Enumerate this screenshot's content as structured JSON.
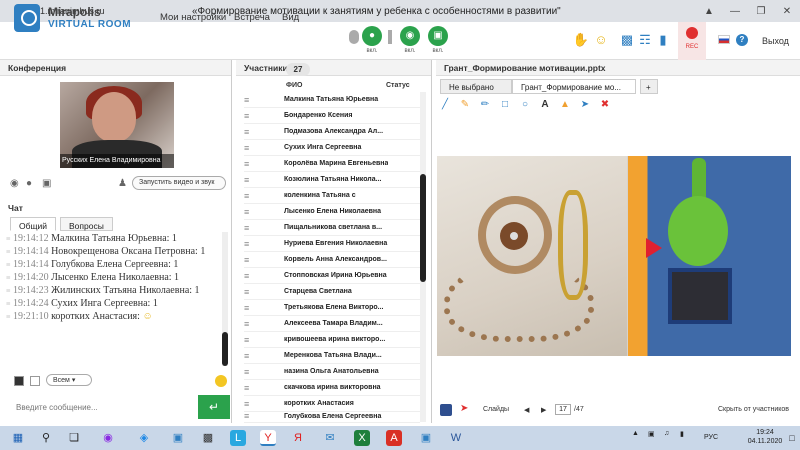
{
  "browser": {
    "url": "mf1.miranimbus.ru",
    "title": "«Формирование мотивации к занятиям у ребенка с особенностями в развитии\""
  },
  "header": {
    "logo_line1": "Mirapolis",
    "logo_line2": "VIRTUAL ROOM",
    "menu": [
      "Мои настройки",
      "Встреча",
      "Вид"
    ],
    "controls": [
      {
        "label": "вкл.",
        "icon": "microphone-icon"
      },
      {
        "label": "вкл.",
        "icon": "camera-icon"
      },
      {
        "label": "вкл.",
        "icon": "screen-share-icon"
      }
    ],
    "rec_label": "REC",
    "help_label": "?",
    "exit_label": "Выход",
    "accent_color": "#2ba24c"
  },
  "conference": {
    "title": "Конференция",
    "video_name": "Русских Елена Владимировна",
    "start_video_label": "Запустить видео и звук"
  },
  "chat": {
    "title": "Чат",
    "tabs": [
      "Общий",
      "Вопросы"
    ],
    "messages": [
      {
        "time": "19:14:12",
        "text": "Малкина Татьяна  Юрьевна: 1"
      },
      {
        "time": "19:14:14",
        "text": "Новокрещенова  Оксана Петровна: 1"
      },
      {
        "time": "19:14:14",
        "text": "Голубкова  Елена Сергеевна: 1"
      },
      {
        "time": "19:14:20",
        "text": "Лысенко Елена  Николаевна: 1"
      },
      {
        "time": "19:14:23",
        "text": "Жилинских  Татьяна Николаевна: 1"
      },
      {
        "time": "19:14:24",
        "text": "Сухих  Инга Сергеевна: 1"
      },
      {
        "time": "19:21:10",
        "text": "коротких Анастасия:"
      }
    ],
    "audience": "Всем",
    "input_placeholder": "Введите сообщение..."
  },
  "participants": {
    "title": "Участники",
    "count": "27",
    "col_name": "ФИО",
    "col_status": "Статус",
    "list": [
      "Малкина Татьяна  Юрьевна",
      "Бондаренко  Ксения",
      "Подмазова Александра  Ал...",
      "Сухих  Инга Сергеевна",
      "Королёва Марина Евгеньевна",
      "Козюлина  Татьяна Никола...",
      "коленкина Татьяна  с",
      "Лысенко Елена  Николаевна",
      "Пищальникова  светлана в...",
      "Нуриева Евгения Николаевна",
      "Корвель Анна  Александров...",
      "Стопповская Ирина Юрьевна",
      "Старцева Светлана",
      "Третьякова  Елена Викторо...",
      "Алексеева Тамара  Владим...",
      "кривошеева  ирина викторо...",
      "Меренкова  Татьяна Влади...",
      "назина  Ольга Анатольевна",
      "скачкова ирина викторовна",
      "коротких Анастасия",
      "Голубкова  Елена Сергеевна"
    ]
  },
  "presentation": {
    "title": "Грант_Формирование мотивации.pptx",
    "tabs": [
      "Не выбрано",
      "Грант_Формирование мо...",
      "+"
    ],
    "slides_label": "Слайды",
    "page": "17",
    "total": "/47",
    "hide_label": "Скрыть от участников"
  },
  "taskbar": {
    "lang": "РУС",
    "time": "19:24",
    "date": "04.11.2020"
  }
}
